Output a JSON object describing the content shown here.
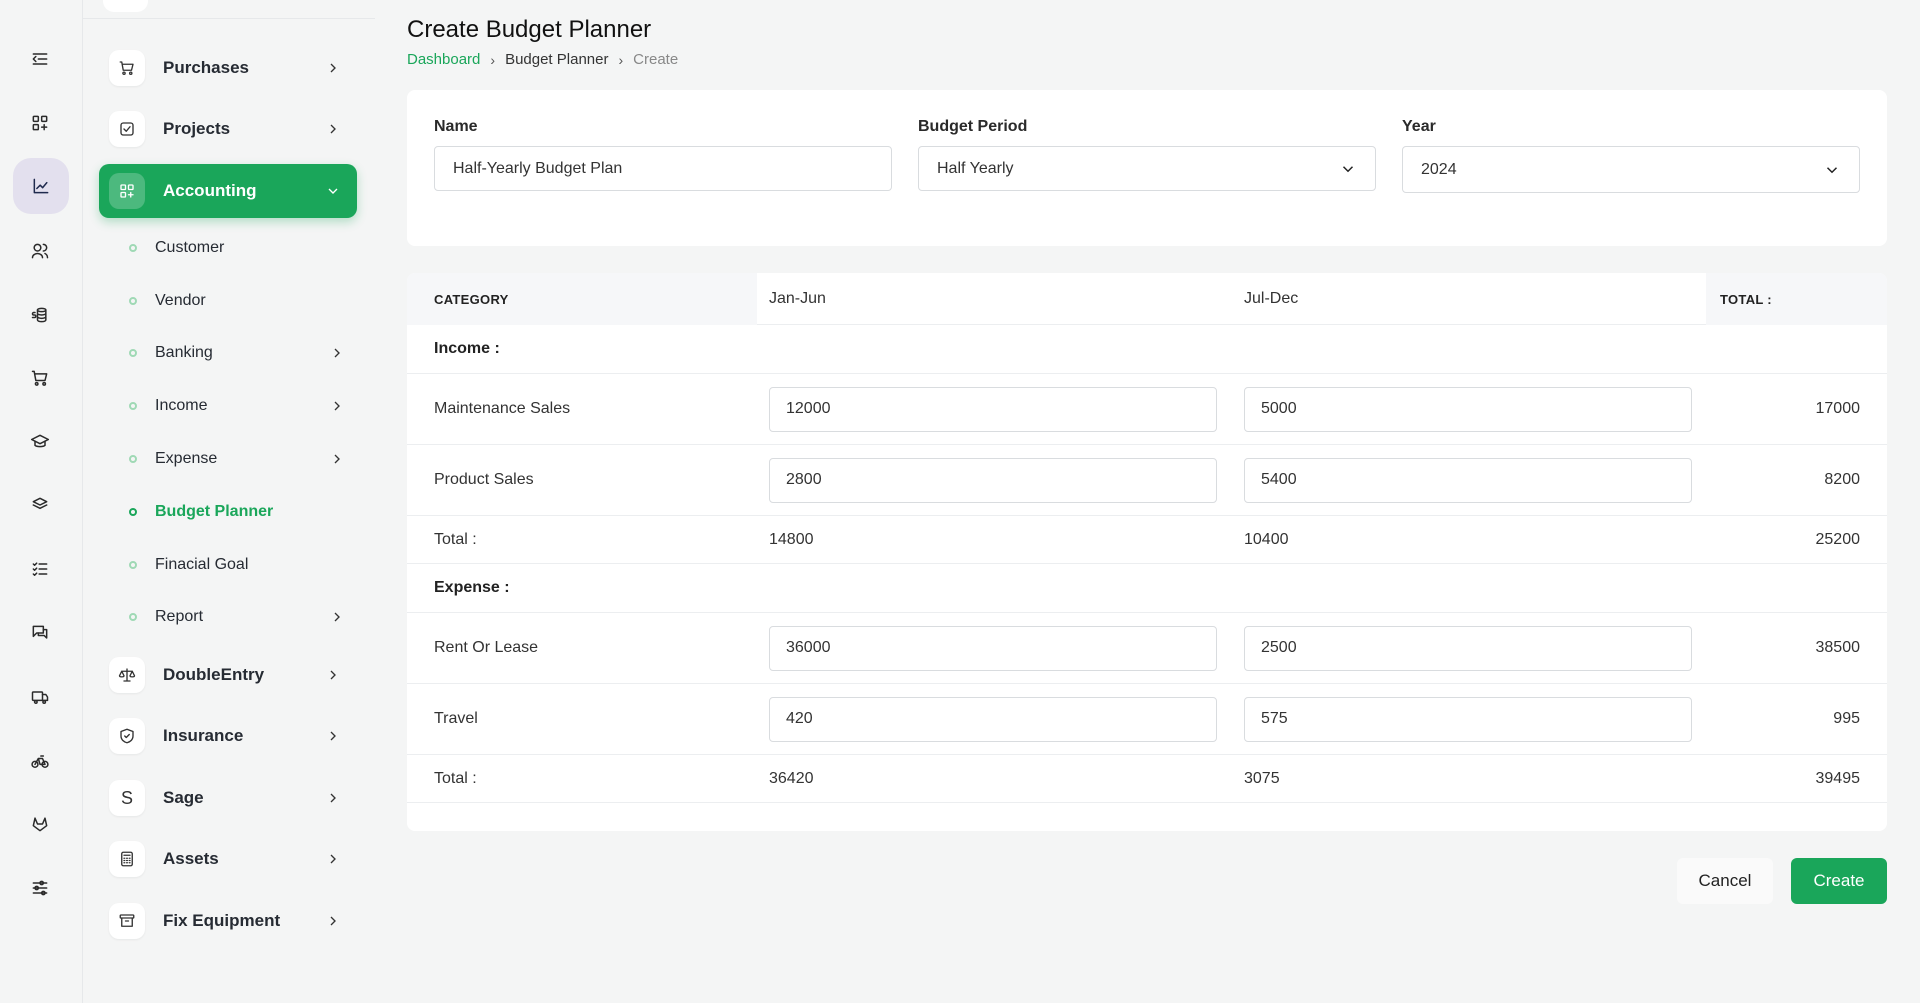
{
  "sidebar": {
    "menu": [
      {
        "label": "Purchases",
        "icon": "cart-icon"
      },
      {
        "label": "Projects",
        "icon": "checkbox-icon"
      },
      {
        "label": "Accounting",
        "icon": "apps-plus-icon",
        "active": true
      },
      {
        "label": "DoubleEntry",
        "icon": "scale-icon"
      },
      {
        "label": "Insurance",
        "icon": "shield-icon"
      },
      {
        "label": "Sage",
        "icon": "letter-s-icon",
        "letter": "S"
      },
      {
        "label": "Assets",
        "icon": "calculator-icon"
      },
      {
        "label": "Fix Equipment",
        "icon": "archive-icon"
      }
    ],
    "submenu": [
      {
        "label": "Customer"
      },
      {
        "label": "Vendor"
      },
      {
        "label": "Banking",
        "chevron": true
      },
      {
        "label": "Income",
        "chevron": true
      },
      {
        "label": "Expense",
        "chevron": true
      },
      {
        "label": "Budget Planner",
        "active": true
      },
      {
        "label": "Finacial Goal"
      },
      {
        "label": "Report",
        "chevron": true
      }
    ]
  },
  "page": {
    "title": "Create Budget Planner",
    "breadcrumb": {
      "home": "Dashboard",
      "section": "Budget Planner",
      "current": "Create"
    }
  },
  "form": {
    "name_label": "Name",
    "name_value": "Half-Yearly Budget Plan",
    "period_label": "Budget Period",
    "period_value": "Half Yearly",
    "year_label": "Year",
    "year_value": "2024"
  },
  "table": {
    "headers": {
      "category": "CATEGORY",
      "p1": "Jan-Jun",
      "p2": "Jul-Dec",
      "total": "TOTAL :"
    },
    "income": {
      "title": "Income :",
      "rows": [
        {
          "name": "Maintenance Sales",
          "p1": "12000",
          "p2": "5000",
          "total": "17000"
        },
        {
          "name": "Product Sales",
          "p1": "2800",
          "p2": "5400",
          "total": "8200"
        }
      ],
      "total": {
        "label": "Total :",
        "p1": "14800",
        "p2": "10400",
        "total": "25200"
      }
    },
    "expense": {
      "title": "Expense :",
      "rows": [
        {
          "name": "Rent Or Lease",
          "p1": "36000",
          "p2": "2500",
          "total": "38500"
        },
        {
          "name": "Travel",
          "p1": "420",
          "p2": "575",
          "total": "995"
        }
      ],
      "total": {
        "label": "Total :",
        "p1": "36420",
        "p2": "3075",
        "total": "39495"
      }
    }
  },
  "actions": {
    "cancel": "Cancel",
    "create": "Create"
  },
  "colors": {
    "accent": "#1aa65a",
    "rail_active": "#e3e0ee"
  }
}
